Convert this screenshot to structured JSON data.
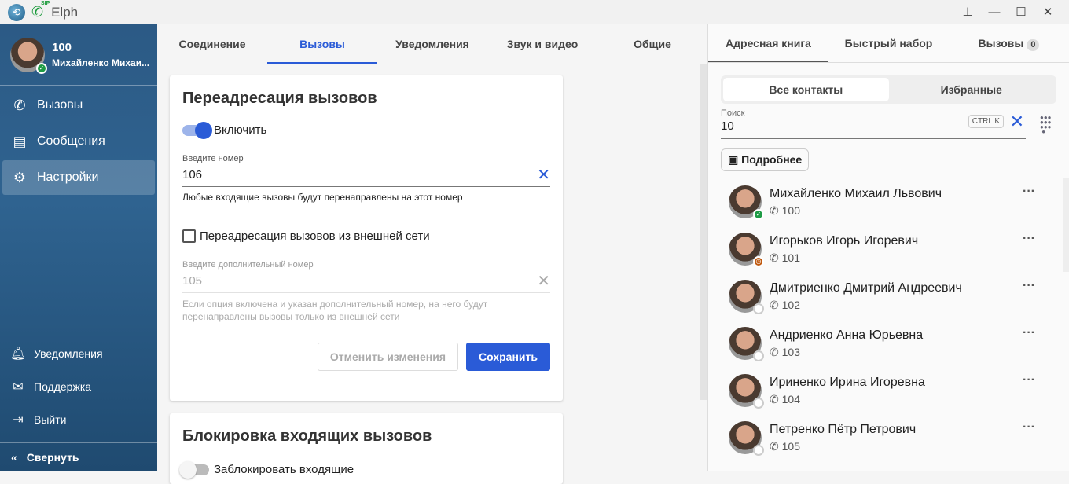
{
  "titlebar": {
    "app_title": "Elph",
    "sip_label": "SIP"
  },
  "user": {
    "number": "100",
    "name": "Михайленко Михаи..."
  },
  "sidebar": {
    "items": [
      {
        "label": "Вызовы",
        "icon": "phone-icon"
      },
      {
        "label": "Сообщения",
        "icon": "chat-icon"
      },
      {
        "label": "Настройки",
        "icon": "gear-icon"
      }
    ],
    "bottom": [
      {
        "label": "Уведомления",
        "icon": "bell-icon"
      },
      {
        "label": "Поддержка",
        "icon": "mail-icon"
      },
      {
        "label": "Выйти",
        "icon": "logout-icon"
      }
    ],
    "collapse": "Свернуть"
  },
  "settings_tabs": [
    "Соединение",
    "Вызовы",
    "Уведомления",
    "Звук и видео",
    "Общие"
  ],
  "forwarding": {
    "title": "Переадресация вызовов",
    "toggle_label": "Включить",
    "number_label": "Введите номер",
    "number_value": "106",
    "number_hint": "Любые входящие вызовы будут перенаправлены на этот номер",
    "external_label": "Переадресация вызовов из внешней сети",
    "extra_label": "Введите дополнительный номер",
    "extra_value": "105",
    "extra_hint": "Если опция включена и указан дополнительный номер, на него будут перенаправлены вызовы только из внешней сети",
    "cancel": "Отменить изменения",
    "save": "Сохранить"
  },
  "blocking": {
    "title": "Блокировка входящих вызовов",
    "toggle_label": "Заблокировать входящие"
  },
  "right_tabs": {
    "address_book": "Адресная книга",
    "speed_dial": "Быстрый набор",
    "calls": "Вызовы",
    "calls_count": "0"
  },
  "segment": {
    "all": "Все контакты",
    "favorites": "Избранные"
  },
  "search": {
    "label": "Поиск",
    "value": "10",
    "shortcut": "CTRL K"
  },
  "details_button": "Подробнее",
  "contacts": [
    {
      "name": "Михайленко Михаил Львович",
      "phone": "100",
      "status": "online"
    },
    {
      "name": "Игорьков Игорь Игоревич",
      "phone": "101",
      "status": "away"
    },
    {
      "name": "Дмитриенко Дмитрий Андреевич",
      "phone": "102",
      "status": "offline"
    },
    {
      "name": "Андриенко Анна Юрьевна",
      "phone": "103",
      "status": "offline"
    },
    {
      "name": "Ириненко Ирина Игоревна",
      "phone": "104",
      "status": "offline"
    },
    {
      "name": "Петренко Пётр Петрович",
      "phone": "105",
      "status": "offline"
    }
  ]
}
